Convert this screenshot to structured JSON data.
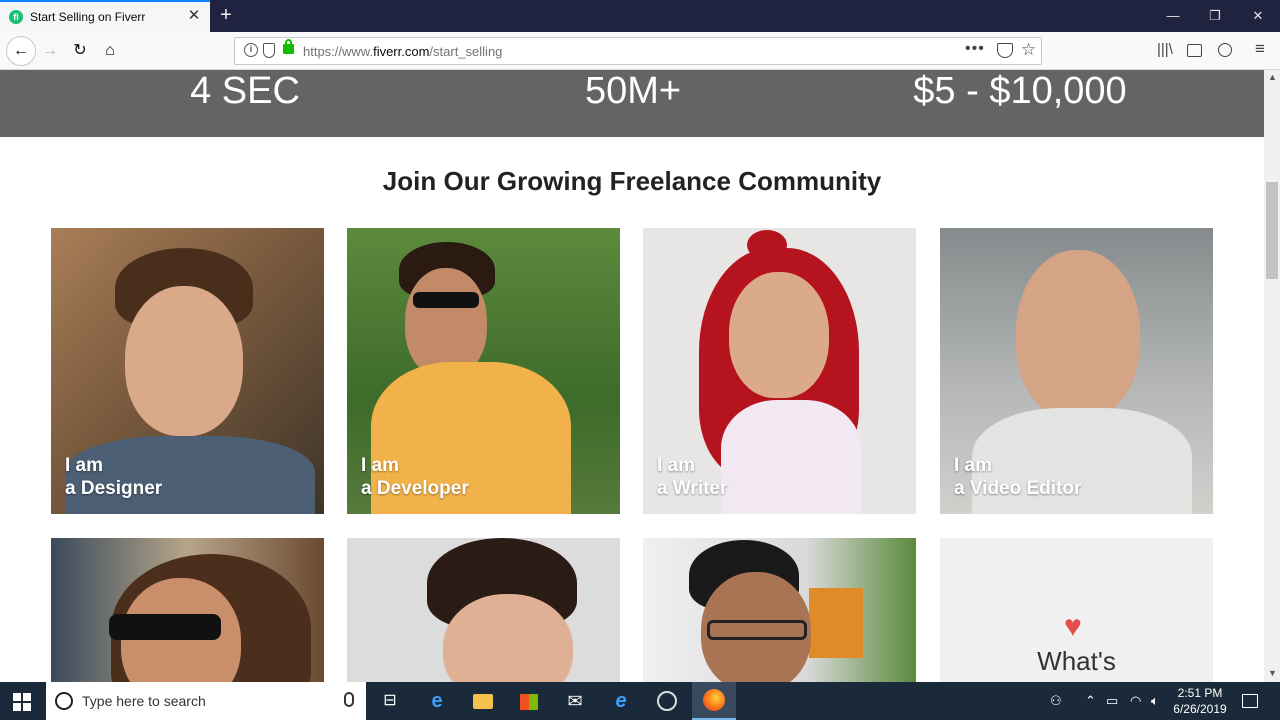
{
  "browser": {
    "tab_title": "Start Selling on Fiverr",
    "tab_favicon_letter": "fi",
    "url_prefix": "https://www.",
    "url_domain": "fiverr.com",
    "url_path": "/start_selling"
  },
  "stats": [
    "4 SEC",
    "50M+",
    "$5 - $10,000"
  ],
  "heading": "Join Our Growing Freelance Community",
  "cards": [
    {
      "line1": "I am",
      "line2": "a Designer"
    },
    {
      "line1": "I am",
      "line2": "a Developer"
    },
    {
      "line1": "I am",
      "line2": "a Writer"
    },
    {
      "line1": "I am",
      "line2": "a Video Editor"
    }
  ],
  "whats_card": {
    "text": "What's"
  },
  "taskbar": {
    "search_placeholder": "Type here to search",
    "time": "2:51 PM",
    "date": "6/26/2019"
  },
  "colors": {
    "accent": "#1dbf73",
    "stats_band": "#646464",
    "heart": "#e54c4c",
    "taskbar": "#1b2a3a"
  }
}
